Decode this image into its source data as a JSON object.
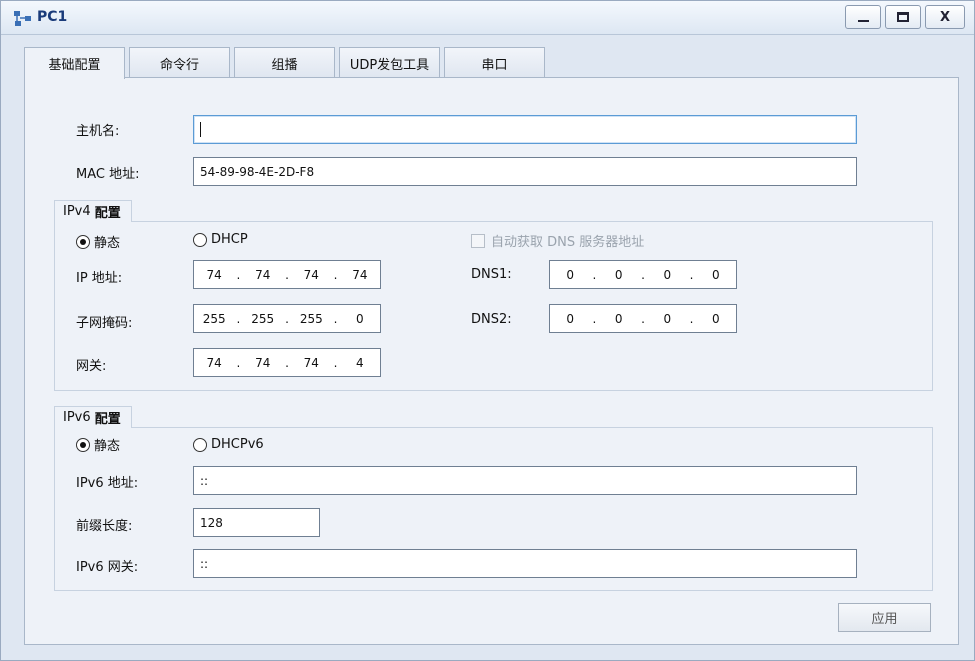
{
  "window": {
    "title": "PC1",
    "minimize_glyph": "",
    "close_label": "X"
  },
  "tabs": [
    {
      "label": "基础配置",
      "active": true
    },
    {
      "label": "命令行"
    },
    {
      "label": "组播"
    },
    {
      "label": "UDP发包工具"
    },
    {
      "label": "串口"
    }
  ],
  "basic": {
    "hostname_label": "主机名:",
    "hostname_value": "",
    "mac_label": "MAC 地址:",
    "mac_value": "54-89-98-4E-2D-F8"
  },
  "ipv4": {
    "group_title_prefix": "IPv4",
    "group_title_bold": "配置",
    "static_label": "静态",
    "dhcp_label": "DHCP",
    "mode": "static",
    "auto_dns_label": "自动获取 DNS 服务器地址",
    "ip_label": "IP 地址:",
    "ip": [
      "74",
      "74",
      "74",
      "74"
    ],
    "mask_label": "子网掩码:",
    "mask": [
      "255",
      "255",
      "255",
      "0"
    ],
    "gateway_label": "网关:",
    "gateway": [
      "74",
      "74",
      "74",
      "4"
    ],
    "dns1_label": "DNS1:",
    "dns1": [
      "0",
      "0",
      "0",
      "0"
    ],
    "dns2_label": "DNS2:",
    "dns2": [
      "0",
      "0",
      "0",
      "0"
    ]
  },
  "ipv6": {
    "group_title_prefix": "IPv6",
    "group_title_bold": "配置",
    "static_label": "静态",
    "dhcp_label": "DHCPv6",
    "mode": "static",
    "ip_label": "IPv6 地址:",
    "ip_value": "::",
    "prefix_label": "前缀长度:",
    "prefix_value": "128",
    "gateway_label": "IPv6 网关:",
    "gateway_value": "::"
  },
  "apply_label": "应用",
  "icons": {
    "app": "network-pc-icon"
  },
  "colors": {
    "title_text": "#1a3b7a",
    "focus_border": "#5b9bd5",
    "panel_bg": "#eef2f8"
  }
}
